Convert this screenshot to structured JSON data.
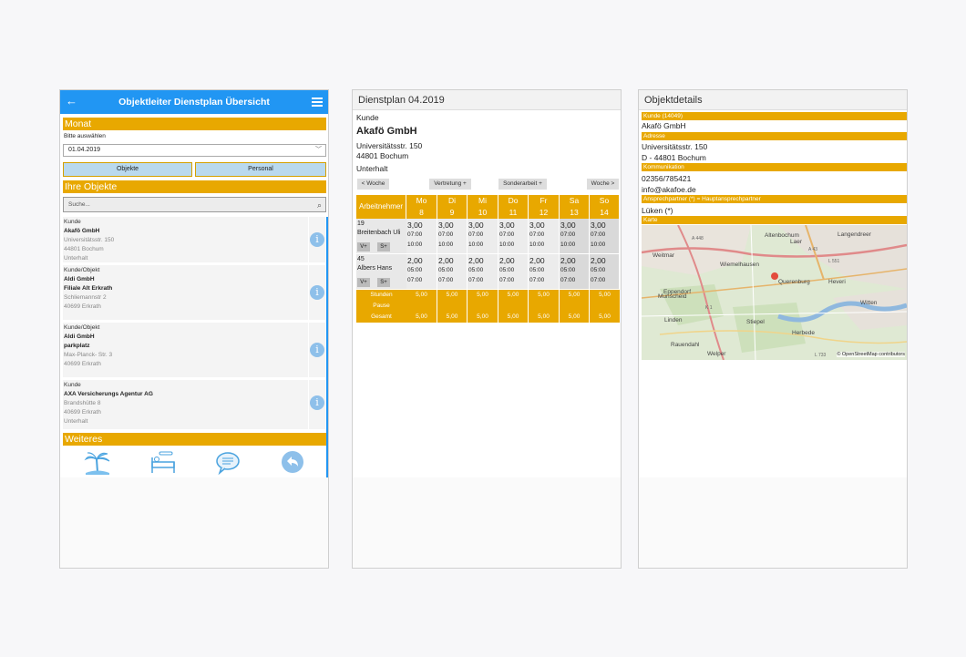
{
  "panel1": {
    "title": "Objektleiter Dienstplan Übersicht",
    "back_glyph": "←",
    "sections": {
      "monat": "Monat",
      "objekte": "Ihre Objekte",
      "weiteres": "Weiteres"
    },
    "select_label": "Bitte auswählen",
    "month_value": "01.04.2019",
    "tab_objekte": "Objekte",
    "tab_personal": "Personal",
    "search_placeholder": "Suche...",
    "cards": [
      {
        "l1": "Kunde",
        "l2": "Akafö GmbH",
        "l3": "Universitätsstr. 150",
        "l4": "44801 Bochum",
        "l5": "Unterhalt"
      },
      {
        "l1": "Kunde/Objekt",
        "l2": "Aldi GmbH",
        "l3": "Filiale Alt Erkrath",
        "l4": "Schliemannstr 2",
        "l5": "40699 Erkrath"
      },
      {
        "l1": "Kunde/Objekt",
        "l2": "Aldi GmbH",
        "l3": "parkplatz",
        "l4": "Max-Planck- Str. 3",
        "l5": "40699 Erkrath"
      },
      {
        "l1": "Kunde",
        "l2": "AXA Versicherungs Agentur AG",
        "l3": "Brandshütte 8",
        "l4": "40699 Erkrath",
        "l5": "Unterhalt"
      }
    ],
    "info_glyph": "i",
    "bottom_icons": [
      "palm-tree-icon",
      "sick-bed-icon",
      "chat-icon",
      "reply-icon"
    ],
    "accent": "#e8a800",
    "brand": "#2196f3"
  },
  "panel2": {
    "title": "Dienstplan 04.2019",
    "kunde_label": "Kunde",
    "kunde_name": "Akafö GmbH",
    "street": "Universitätsstr. 150",
    "city": "44801 Bochum",
    "type": "Unterhalt",
    "btn_prev": "< Woche",
    "btn_vertretung": "Vertretung +",
    "btn_sonder": "Sonderarbeit +",
    "btn_next": "Woche >",
    "header_label": "Arbeitnehmer",
    "days": [
      {
        "d": "Mo",
        "n": "8"
      },
      {
        "d": "Di",
        "n": "9"
      },
      {
        "d": "Mi",
        "n": "10"
      },
      {
        "d": "Do",
        "n": "11"
      },
      {
        "d": "Fr",
        "n": "12"
      },
      {
        "d": "Sa",
        "n": "13"
      },
      {
        "d": "So",
        "n": "14"
      }
    ],
    "employees": [
      {
        "id": "19",
        "name": "Breitenbach Uli",
        "hours": "3,00",
        "from": "07:00",
        "to": "10:00"
      },
      {
        "id": "45",
        "name": "Albers Hans",
        "hours": "2,00",
        "from": "05:00",
        "to": "07:00"
      }
    ],
    "v_btn": "V+",
    "s_btn": "S+",
    "sum_labels": {
      "stunden": "Stunden",
      "pause": "Pause",
      "gesamt": "Gesamt"
    },
    "sum_value": "5,00"
  },
  "panel3": {
    "title": "Objektdetails",
    "sec_kunde": "Kunde (14049)",
    "kunde": "Akafö GmbH",
    "sec_adresse": "Adresse",
    "street": "Universitätsstr. 150",
    "city": "D - 44801 Bochum",
    "sec_komm": "Kommunikation",
    "phone": "02356/785421",
    "email": "info@akafoe.de",
    "sec_ansprech": "Ansprechpartner   (*) = Hauptansprechpartner",
    "contact": "Lüken (*)",
    "sec_karte": "Karte",
    "map_labels": {
      "altenbochum": "Altenbochum",
      "laer": "Laer",
      "langendreer": "Langendreer",
      "weitmar": "Weitmar",
      "wiemelhausen": "Wiemelhausen",
      "eppendorf": "Eppendorf",
      "querenburg": "Querenburg",
      "munscheid": "Munscheid",
      "witten": "Witten",
      "linden": "Linden",
      "stiepel": "Stiepel",
      "heveri": "Heveri",
      "herbede": "Herbede",
      "rauendahl": "Rauendahl",
      "welper": "Welper",
      "a448": "A 448",
      "a43": "A 43",
      "k1": "K 1",
      "l551": "L 551",
      "l733": "L 733",
      "attribution": "© OpenStreetMap contributors"
    }
  }
}
